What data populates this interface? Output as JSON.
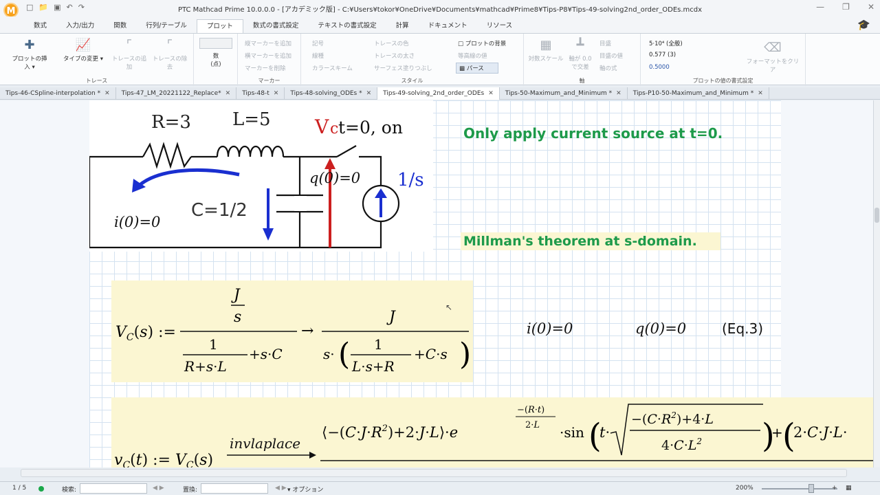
{
  "app": {
    "title": "PTC Mathcad Prime 10.0.0.0 - [アカデミック版] - C:¥Users¥tokor¥OneDrive¥Documents¥mathcad¥Prime8¥Tips-P8¥Tips-49-solving2nd_order_ODEs.mcdx",
    "logo": "M"
  },
  "ribbon_tabs": [
    "数式",
    "入力/出力",
    "関数",
    "行列/テーブル",
    "プロット",
    "数式の書式設定",
    "テキストの書式設定",
    "計算",
    "ドキュメント",
    "リソース"
  ],
  "active_ribbon_tab": 4,
  "ribbon": {
    "trace_group": "トレース",
    "insert_plot": "プロットの挿入",
    "change_type": "タイプの変更",
    "add_trace": "トレースの追加",
    "remove_trace": "トレースの除去",
    "points_top": "数",
    "points_bottom": "(点)",
    "marker_group": "マーカー",
    "add_vmarker": "縦マーカーを追加",
    "add_hmarker": "横マーカーを追加",
    "delete_marker": "マーカーを削除",
    "style_group": "スタイル",
    "symbol": "記号",
    "line_type": "線種",
    "color_scheme": "カラースキーム",
    "trace_color": "トレースの色",
    "trace_size": "トレースの太さ",
    "surface_fill": "サーフェス塗りつぶし",
    "plot_background": "プロットの背景",
    "contour_value": "等高線の値",
    "perspective": "パース",
    "axis_group": "軸",
    "log_scale": "対数スケール",
    "axes_cross": "軸が 0.0",
    "axes_cross2": "で交差",
    "grid": "目盛",
    "grid_value": "目盛の値",
    "axis_expr": "軸の式",
    "value_format_group": "プロットの値の書式設定",
    "fmt_value1": "5·10⁴ (全般)",
    "fmt_value2": "0.577 (3)",
    "fmt_value3": "0.5000",
    "clear_format": "フォーマットをクリア"
  },
  "doc_tabs": [
    {
      "label": "Tips-46-CSpline-interpolation *"
    },
    {
      "label": "Tips-47_LM_20221122_Replace*"
    },
    {
      "label": "Tips-48-t"
    },
    {
      "label": "Tips-48-solving_ODEs *"
    },
    {
      "label": "Tips-49-solving_2nd_order_ODEs"
    },
    {
      "label": "Tips-50-Maximum_and_Minimum *"
    },
    {
      "label": "Tips-P10-50-Maximum_and_Minimum *"
    }
  ],
  "active_doc_tab": 4,
  "circuit": {
    "R_label": "R=3",
    "L_label": "L=5",
    "switch_label_V": "V",
    "switch_label_c": "c",
    "switch_label_rest": " t=0, on",
    "C_label": "C=1/2",
    "q0_label": "q(0)=0",
    "i0_label": "i(0)=0",
    "source_label": "1/s"
  },
  "notes": {
    "note1": "Only apply current source at t=0.",
    "note2": "Millman's theorem at s-domain."
  },
  "eq3": {
    "i0": "i(0)=0",
    "q0": "q(0)=0",
    "label": "(Eq.3)"
  },
  "status": {
    "page": "1 / 5",
    "search_label": "検索:",
    "replace_label": "置換:",
    "options_label": "オプション",
    "zoom": "200%"
  },
  "colors": {
    "accent_green": "#1d9a4a",
    "math_blue": "#2b2f8c",
    "circuit_red": "#cc1f1f",
    "circuit_blue": "#1a2fd0",
    "math_bg": "#fbf6d2"
  }
}
